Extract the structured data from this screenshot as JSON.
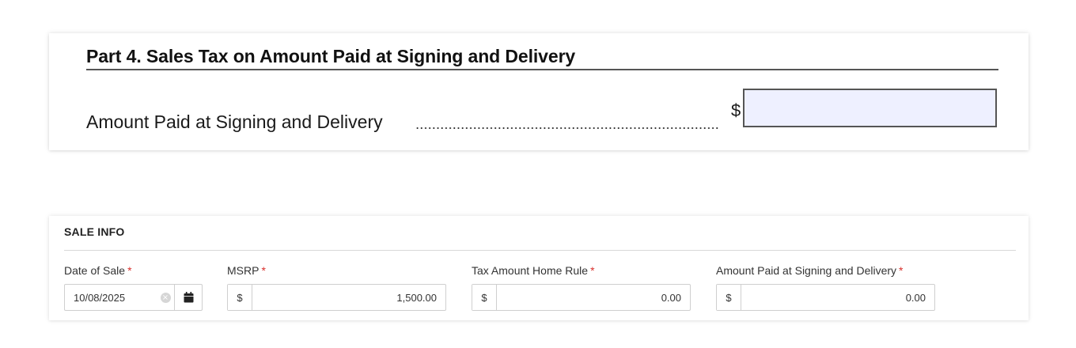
{
  "form_excerpt": {
    "part_title": "Part 4. Sales Tax on Amount Paid at Signing and Delivery",
    "line_label": "Amount Paid at Signing and Delivery",
    "currency_symbol": "$",
    "amount_value": ""
  },
  "sale_info": {
    "heading": "SALE INFO",
    "required_marker": "*",
    "fields": [
      {
        "label": "Date of Sale",
        "value": "10/08/2025",
        "icons": [
          "clear-icon",
          "calendar-icon"
        ]
      },
      {
        "label": "MSRP",
        "prefix": "$",
        "value": "1,500.00"
      },
      {
        "label": "Tax Amount Home Rule",
        "prefix": "$",
        "value": "0.00"
      },
      {
        "label": "Amount Paid at Signing and Delivery",
        "prefix": "$",
        "value": "0.00"
      }
    ]
  },
  "colors": {
    "required": "#d9302c",
    "form_field_fill": "#eef0ff",
    "border": "#cfcfcf"
  }
}
